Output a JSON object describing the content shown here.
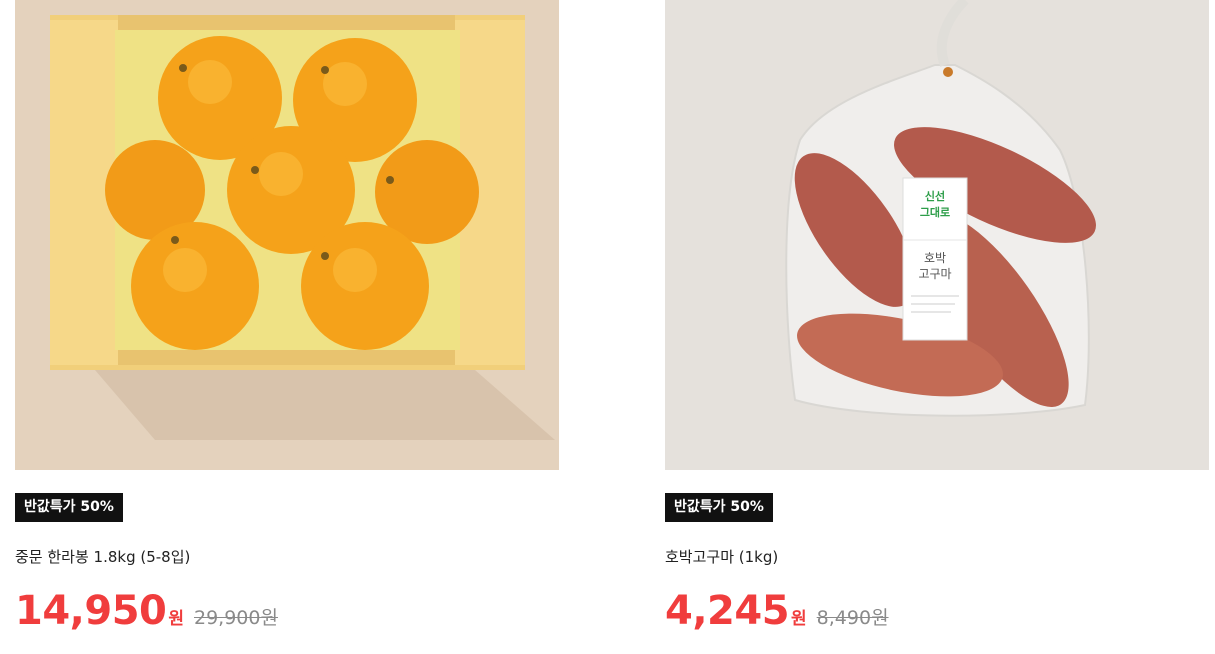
{
  "products": [
    {
      "badge": "반값특가 50%",
      "name": "중문 한라봉 1.8kg (5-8입)",
      "sale_price": "14,950",
      "currency": "원",
      "original_price": "29,900원",
      "image": "box-of-hallabong-oranges"
    },
    {
      "badge": "반값특가 50%",
      "name": "호박고구마 (1kg)",
      "sale_price": "4,245",
      "currency": "원",
      "original_price": "8,490원",
      "image": "bag-of-sweet-potatoes",
      "label": {
        "brand_line1": "신선",
        "brand_line2": "그대로",
        "product_line1": "호박",
        "product_line2": "고구마"
      }
    }
  ],
  "colors": {
    "sale": "#f03d3d",
    "badge_bg": "#111111",
    "original": "#8a8a8a"
  }
}
